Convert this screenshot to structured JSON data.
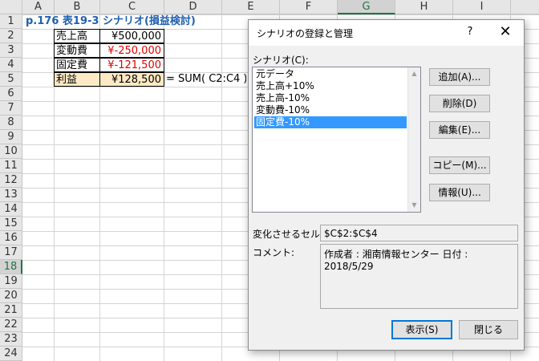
{
  "sheet": {
    "columns": [
      "A",
      "B",
      "C",
      "D",
      "E",
      "F",
      "G",
      "H",
      "I"
    ],
    "rows": [
      "1",
      "2",
      "3",
      "4",
      "5",
      "6",
      "7",
      "8",
      "9",
      "10",
      "11",
      "12",
      "13",
      "14",
      "15",
      "16",
      "17",
      "18",
      "19",
      "20",
      "21",
      "22",
      "23",
      "24"
    ],
    "selected_column": "G",
    "selected_row": "18",
    "title": "p.176  表19-3 シナリオ(損益検討)",
    "table": [
      {
        "label": "売上高",
        "value": "¥500,000",
        "negative": false
      },
      {
        "label": "変動費",
        "value": "¥-250,000",
        "negative": true
      },
      {
        "label": "固定費",
        "value": "¥-121,500",
        "negative": true
      },
      {
        "label": "利益",
        "value": "¥128,500",
        "negative": false
      }
    ],
    "formula_note": "= SUM( C2:C4 )"
  },
  "dialog": {
    "title": "シナリオの登録と管理",
    "help_label": "?",
    "close_label": "✕",
    "scenario_label": "シナリオ(C):",
    "scenarios": [
      "元データ",
      "売上高+10%",
      "売上高-10%",
      "変動費-10%",
      "固定費-10%"
    ],
    "selected_scenario": "固定費-10%",
    "buttons": {
      "add": "追加(A)...",
      "delete": "削除(D)",
      "edit": "編集(E)...",
      "copy": "コピー(M)...",
      "info": "情報(U)...",
      "show": "表示(S)",
      "close": "閉じる"
    },
    "changing_cells_label": "変化させるセル:",
    "changing_cells_value": "$C$2:$C$4",
    "comment_label": "コメント:",
    "comment_value": "作成者 : 湘南情報センター 日付 : 2018/5/29"
  },
  "colors": {
    "accent": "#217346",
    "title_blue": "#1f5fb0",
    "negative_red": "#e00000",
    "highlight_tan": "#fde9c3",
    "selection_blue": "#3399ff"
  }
}
